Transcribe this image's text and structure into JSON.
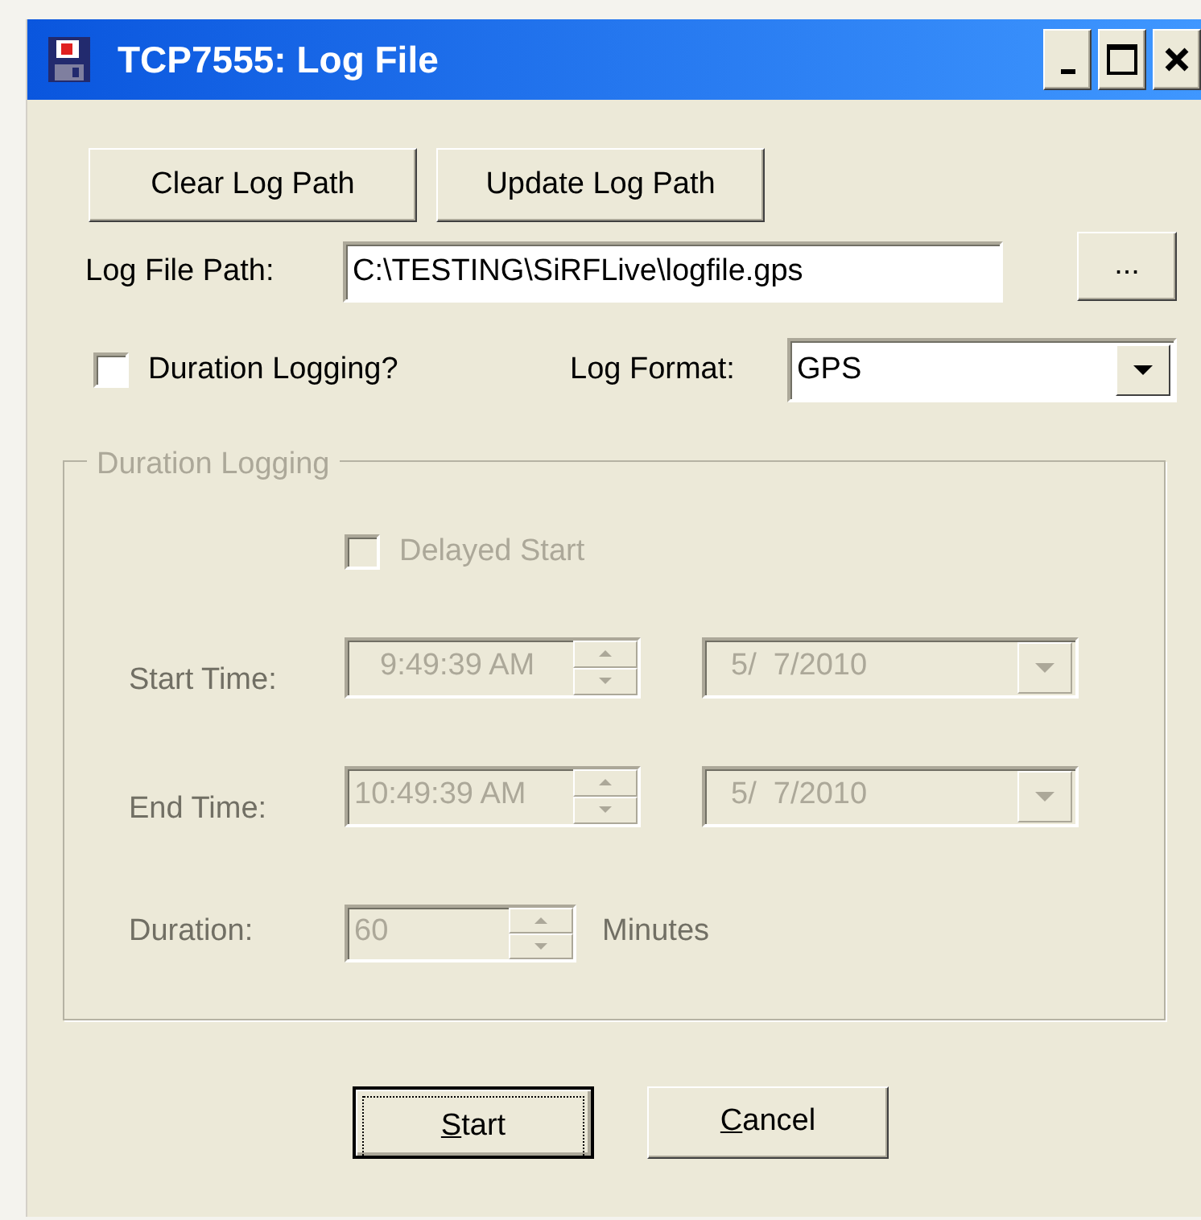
{
  "window": {
    "title": "TCP7555: Log File",
    "controls": [
      {
        "kind": "minimize"
      },
      {
        "kind": "maximize"
      },
      {
        "kind": "close"
      }
    ]
  },
  "path_buttons": [
    {
      "label": "Clear Log Path"
    },
    {
      "label": "Update Log Path"
    }
  ],
  "log_file_path": {
    "label": "Log File Path:",
    "value": "C:\\TESTING\\SiRFLive\\logfile.gps",
    "browse_label": "..."
  },
  "duration_logging": {
    "label": "Duration Logging?",
    "checked": false
  },
  "log_format": {
    "label": "Log Format:",
    "value": "GPS"
  },
  "group": {
    "title": "Duration Logging",
    "disabled": true,
    "delayed_start": {
      "label": "Delayed Start",
      "checked": false
    },
    "start_time": {
      "label": "Start Time:",
      "time": "9:49:39 AM",
      "date": "5/  7/2010"
    },
    "end_time": {
      "label": "End Time:",
      "time": "10:49:39 AM",
      "date": "5/  7/2010"
    },
    "duration": {
      "label": "Duration:",
      "value": "60",
      "unit": "Minutes"
    }
  },
  "buttons": [
    {
      "accel": "S",
      "rest": "tart",
      "default": true
    },
    {
      "accel": "C",
      "rest": "ancel",
      "default": false
    }
  ]
}
